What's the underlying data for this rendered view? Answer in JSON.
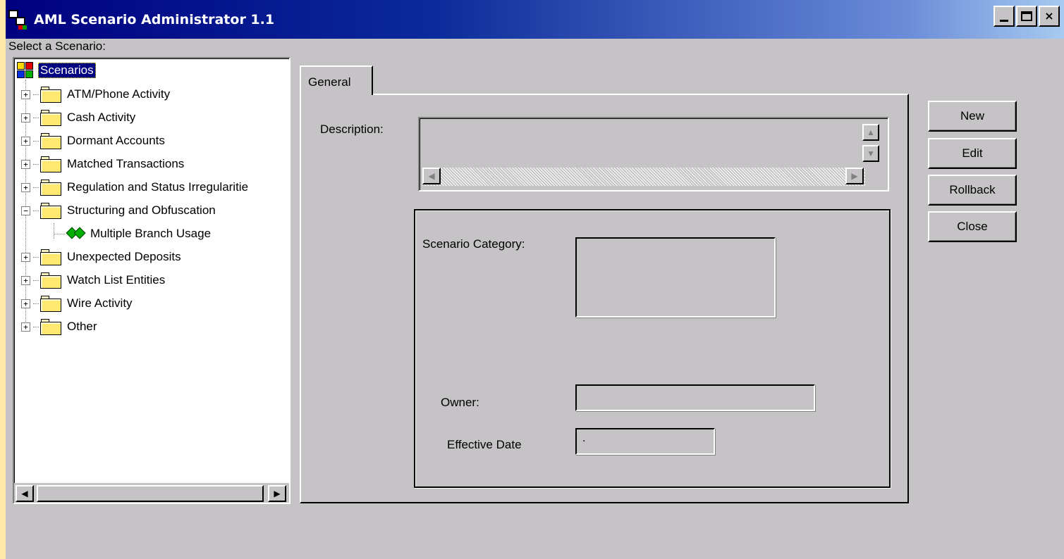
{
  "window": {
    "title": "AML Scenario Administrator 1.1",
    "controls": [
      "minimize",
      "maximize",
      "close"
    ],
    "close_glyph": "×"
  },
  "tree_panel": {
    "label": "Select a Scenario:",
    "root": "Scenarios",
    "items": [
      {
        "label": "ATM/Phone Activity",
        "expander": "+"
      },
      {
        "label": "Cash Activity",
        "expander": "+"
      },
      {
        "label": "Dormant Accounts",
        "expander": "+"
      },
      {
        "label": "Matched Transactions",
        "expander": "+"
      },
      {
        "label": "Regulation and Status Irregularitie",
        "expander": "+"
      },
      {
        "label": "Structuring and Obfuscation",
        "expander": "−",
        "children": [
          "Multiple Branch Usage"
        ]
      },
      {
        "label": "Unexpected Deposits",
        "expander": "+"
      },
      {
        "label": "Watch List Entities",
        "expander": "+"
      },
      {
        "label": "Wire Activity",
        "expander": "+"
      },
      {
        "label": "Other",
        "expander": "+"
      }
    ],
    "scroll_left": "◀",
    "scroll_right": "▶"
  },
  "tabs": {
    "active": "General"
  },
  "form": {
    "description_label": "Description:",
    "description_value": "",
    "scenario_category_label": "Scenario Category:",
    "scenario_category_value": "",
    "owner_label": "Owner:",
    "owner_value": "",
    "effective_date_label": "Effective Date",
    "effective_date_value": "."
  },
  "buttons": {
    "new": "New",
    "edit": "Edit",
    "rollback": "Rollback",
    "close": "Close"
  },
  "colors": {
    "titlebar": "#000080",
    "face": "#C6C3C6",
    "selection": "#000080",
    "desktop": "#FFE9A8"
  }
}
